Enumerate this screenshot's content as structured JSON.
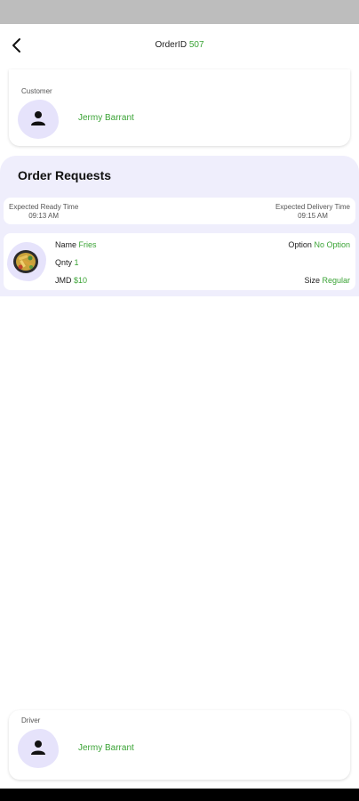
{
  "header": {
    "order_label": "OrderID",
    "order_id": "507"
  },
  "customer": {
    "label": "Customer",
    "name": "Jermy Barrant"
  },
  "order_requests": {
    "title": "Order Requests",
    "ready_label": "Expected Ready Time",
    "ready_time": "09:13 AM",
    "delivery_label": "Expected Delivery Time",
    "delivery_time": "09:15 AM",
    "item": {
      "name_label": "Name",
      "name": "Fries",
      "qty_label": "Qnty",
      "qty": "1",
      "currency": "JMD",
      "price": "$10",
      "option_label": "Option",
      "option": "No Option",
      "size_label": "Size",
      "size": "Regular"
    }
  },
  "driver": {
    "label": "Driver",
    "name": "Jermy Barrant"
  },
  "colors": {
    "accent_green": "#3aa335",
    "panel_bg": "#efeefc",
    "blob": "#e6e3fb"
  },
  "icons": [
    "arrow-left-icon",
    "person-icon",
    "food-image"
  ]
}
